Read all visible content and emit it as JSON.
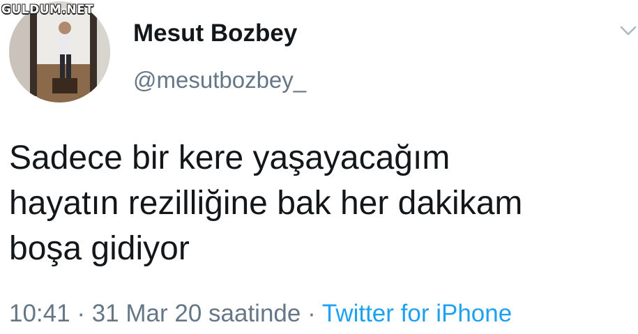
{
  "watermark": "GULDUM.NET",
  "profile": {
    "display_name": "Mesut Bozbey",
    "handle": "@mesutbozbey_"
  },
  "tweet": {
    "lines": [
      "Sadece bir kere yaşayacağım",
      "hayatın rezilliğine bak her dakikam",
      "boşa gidiyor"
    ],
    "time": "10:41",
    "separator": "·",
    "date_label": "31 Mar 20 saatinde",
    "source": "Twitter for iPhone"
  },
  "icons": {
    "menu": "chevron-down-icon"
  },
  "colors": {
    "text": "#14171a",
    "secondary": "#657786",
    "link": "#1da1f2"
  }
}
